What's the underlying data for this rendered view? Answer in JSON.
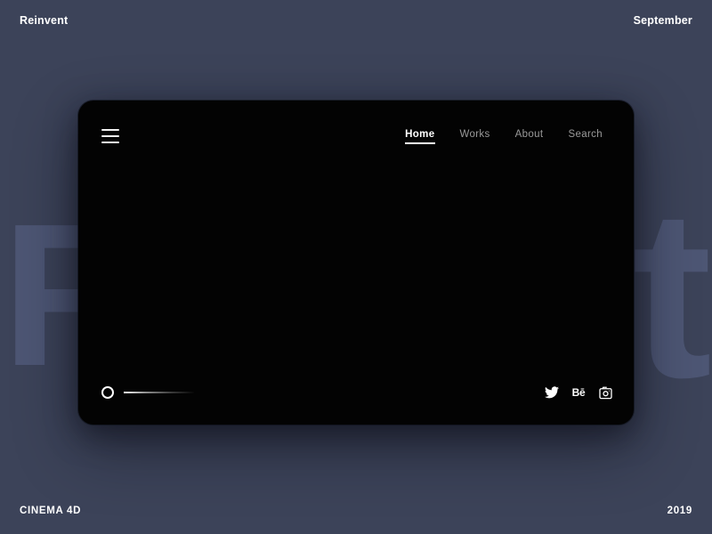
{
  "page": {
    "background_color": "#3c4359",
    "accent_color": "#ffffff"
  },
  "background_typography": {
    "left_letter": "R",
    "right_letter": "t",
    "color": "#4d5674",
    "source_word": "Reinvent"
  },
  "header": {
    "brand": "Reinvent",
    "month": "September"
  },
  "footer": {
    "software": "CINEMA 4D",
    "year": "2019"
  },
  "player_card": {
    "background_color": "#030303",
    "menu_icon": "hamburger-icon",
    "nav": [
      {
        "label": "Home",
        "active": true
      },
      {
        "label": "Works",
        "active": false
      },
      {
        "label": "About",
        "active": false
      },
      {
        "label": "Search",
        "active": false
      }
    ],
    "controls": {
      "play_icon": "circle-outline-icon",
      "progress_value": 0
    },
    "socials": [
      {
        "name": "twitter-icon",
        "label": "Twitter"
      },
      {
        "name": "behance-icon",
        "label": "Bē"
      },
      {
        "name": "instagram-icon",
        "label": "Instagram"
      }
    ]
  }
}
